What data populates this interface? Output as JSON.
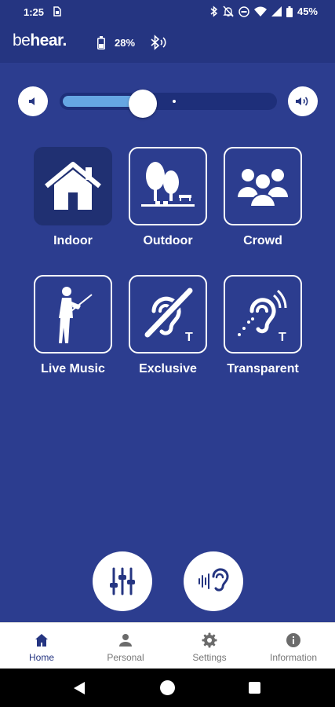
{
  "status_bar": {
    "time": "1:25",
    "battery_percent": "45%",
    "icons": [
      "sim-icon",
      "bluetooth-icon",
      "notifications-off-icon",
      "do-not-disturb-icon",
      "wifi-icon",
      "signal-icon",
      "battery-icon"
    ]
  },
  "app_bar": {
    "logo_be": "be",
    "logo_hear": "hear.",
    "device_battery": "28%",
    "icons": [
      "device-battery-icon",
      "bluetooth-audio-icon"
    ]
  },
  "volume": {
    "level": 0.38,
    "icons": [
      "volume-down-icon",
      "volume-up-icon"
    ],
    "fill_color": "#66a6e3"
  },
  "modes": [
    {
      "label": "Indoor",
      "icon": "house-icon",
      "active": true
    },
    {
      "label": "Outdoor",
      "icon": "trees-icon",
      "active": false
    },
    {
      "label": "Crowd",
      "icon": "crowd-icon",
      "active": false
    },
    {
      "label": "Live Music",
      "icon": "violinist-icon",
      "active": false
    },
    {
      "label": "Exclusive",
      "icon": "hearing-loop-off-icon",
      "active": false
    },
    {
      "label": "Transparent",
      "icon": "hearing-loop-icon",
      "active": false
    }
  ],
  "fabs": [
    {
      "icon": "equalizer-icon"
    },
    {
      "icon": "ear-sound-icon"
    }
  ],
  "bottom_nav": [
    {
      "label": "Home",
      "icon": "home-icon",
      "active": true
    },
    {
      "label": "Personal",
      "icon": "person-icon",
      "active": false
    },
    {
      "label": "Settings",
      "icon": "gear-icon",
      "active": false
    },
    {
      "label": "Information",
      "icon": "info-icon",
      "active": false
    }
  ],
  "colors": {
    "background": "#2c3d8f",
    "header": "#253581",
    "active_tile": "#203072",
    "accent": "#253581"
  }
}
